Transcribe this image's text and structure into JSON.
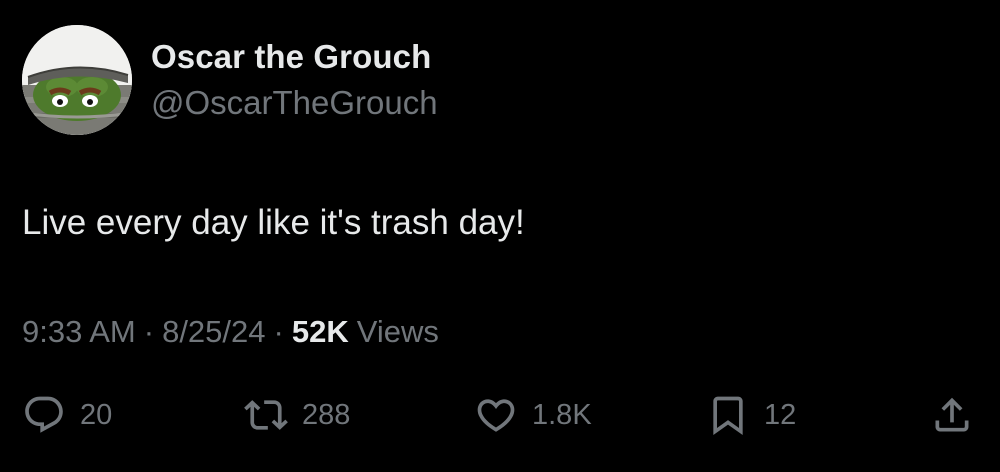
{
  "author": {
    "display_name": "Oscar the Grouch",
    "handle": "@OscarTheGrouch",
    "avatar_icon": "oscar-avatar"
  },
  "tweet": {
    "text": "Live every day like it's trash day!"
  },
  "meta": {
    "time": "9:33 AM",
    "separator": "·",
    "date": "8/25/24",
    "views_count": "52K",
    "views_label": "Views"
  },
  "actions": {
    "reply": {
      "icon": "reply-icon",
      "count": "20"
    },
    "repost": {
      "icon": "repost-icon",
      "count": "288"
    },
    "like": {
      "icon": "heart-icon",
      "count": "1.8K"
    },
    "bookmark": {
      "icon": "bookmark-icon",
      "count": "12"
    },
    "share": {
      "icon": "share-icon"
    }
  },
  "colors": {
    "background": "#000000",
    "primary_text": "#e7e9ea",
    "secondary_text": "#71767b"
  }
}
